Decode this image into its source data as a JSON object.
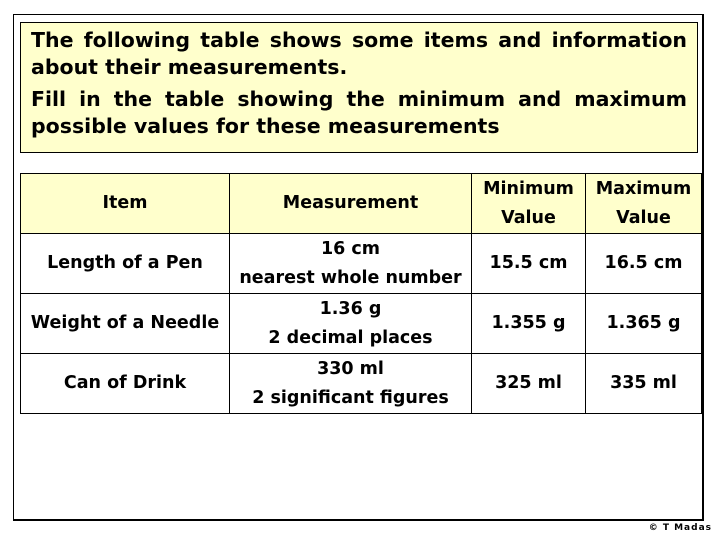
{
  "question": {
    "paragraphs": [
      "The following table shows some items and information about their measurements.",
      "Fill in the table showing the minimum and maximum possible values for these measurements"
    ]
  },
  "table": {
    "headers": [
      {
        "lines": [
          "Item"
        ]
      },
      {
        "lines": [
          "Measurement"
        ]
      },
      {
        "lines": [
          "Minimum",
          "Value"
        ]
      },
      {
        "lines": [
          "Maximum",
          "Value"
        ]
      }
    ],
    "rows": [
      {
        "item": "Length of a Pen",
        "measurement": [
          "16 cm",
          "nearest whole number"
        ],
        "min": "15.5 cm",
        "max": "16.5 cm"
      },
      {
        "item": "Weight of a Needle",
        "measurement": [
          "1.36 g",
          "2 decimal places"
        ],
        "min": "1.355 g",
        "max": "1.365 g"
      },
      {
        "item": "Can of Drink",
        "measurement": [
          "330 ml",
          "2 significant figures"
        ],
        "min": "325 ml",
        "max": "335 ml"
      }
    ]
  },
  "footer": {
    "copyright": "© T Madas"
  },
  "colors": {
    "highlight_fill": "#FFFFCC",
    "border": "#000000"
  }
}
